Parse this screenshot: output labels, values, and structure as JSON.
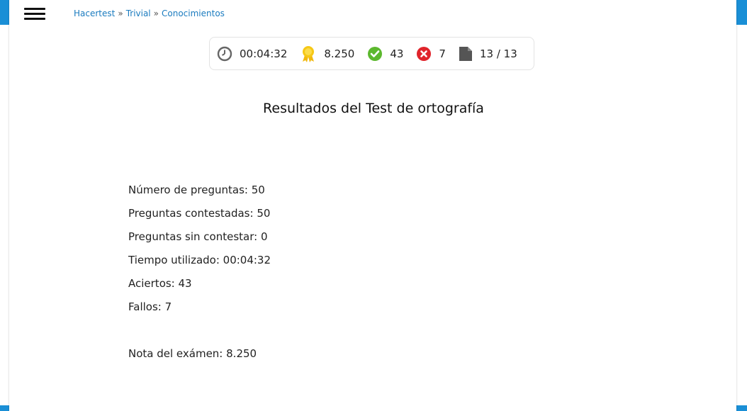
{
  "breadcrumb": {
    "home": "Hacertest",
    "section": "Trivial",
    "current": "Conocimientos",
    "separator": "»"
  },
  "stats": {
    "time": "00:04:32",
    "score": "8.250",
    "correct": "43",
    "wrong": "7",
    "pages": "13 / 13",
    "icons": [
      "clock-icon",
      "medal-icon",
      "check-icon",
      "cross-icon",
      "document-icon"
    ]
  },
  "title": "Resultados del Test de ortografía",
  "results": {
    "questions": "Número de preguntas: 50",
    "answered": "Preguntas contestadas: 50",
    "unanswered": "Preguntas sin contestar: 0",
    "time_used": "Tiempo utilizado: 00:04:32",
    "hits": "Aciertos: 43",
    "misses": "Fallos: 7",
    "grade": "Nota del exámen: 8.250"
  },
  "colors": {
    "accent": "#1a8fd6",
    "link": "#1a7bbf",
    "correct": "#5cb82e",
    "wrong": "#e0242b"
  }
}
